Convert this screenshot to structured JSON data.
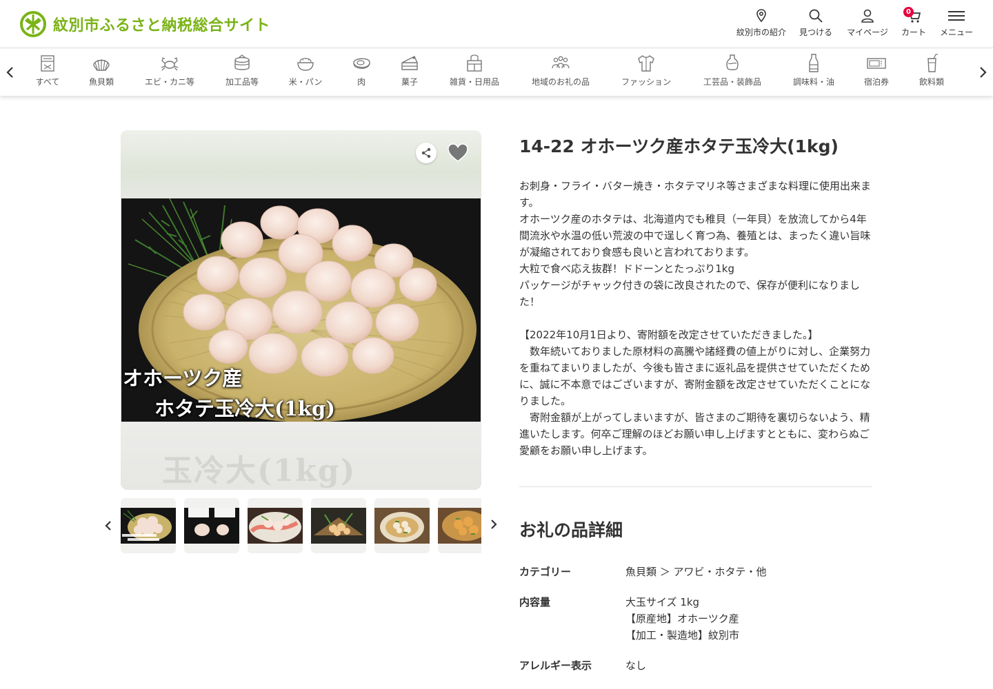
{
  "header": {
    "site_title": "紋別市ふるさと納税総合サイト",
    "nav": [
      {
        "label": "紋別市の紹介",
        "icon": "location-pin-icon"
      },
      {
        "label": "見つける",
        "icon": "search-icon"
      },
      {
        "label": "マイページ",
        "icon": "user-icon"
      },
      {
        "label": "カート",
        "icon": "cart-icon",
        "badge": "0"
      },
      {
        "label": "メニュー",
        "icon": "hamburger-menu-icon"
      }
    ]
  },
  "categories": [
    {
      "label": "すべて",
      "icon": "all-items-icon"
    },
    {
      "label": "魚貝類",
      "icon": "shell-icon"
    },
    {
      "label": "エビ・カニ等",
      "icon": "crab-icon"
    },
    {
      "label": "加工品等",
      "icon": "can-icon"
    },
    {
      "label": "米・パン",
      "icon": "rice-bowl-icon"
    },
    {
      "label": "肉",
      "icon": "meat-icon"
    },
    {
      "label": "菓子",
      "icon": "cake-icon"
    },
    {
      "label": "雑貨・日用品",
      "icon": "shopping-bag-icon"
    },
    {
      "label": "地域のお礼の品",
      "icon": "people-icon"
    },
    {
      "label": "ファッション",
      "icon": "shirt-icon"
    },
    {
      "label": "工芸品・装飾品",
      "icon": "vase-icon"
    },
    {
      "label": "調味料・油",
      "icon": "bottle-icon"
    },
    {
      "label": "宿泊券",
      "icon": "ticket-icon"
    },
    {
      "label": "飲料類",
      "icon": "drink-icon"
    }
  ],
  "product": {
    "image_caption_line1": "オホーツク産",
    "image_caption_line2": "ホタテ玉冷大(1kg)",
    "image_blur_text": "玉冷大(1kg)",
    "title": "14-22 オホーツク産ホタテ玉冷大(1kg)",
    "description": [
      "お刺身・フライ・バター焼き・ホタテマリネ等さまざまな料理に使用出来ます。",
      "オホーツク産のホタテは、北海道内でも稚貝（一年貝）を放流してから4年間流氷や水温の低い荒波の中で逞しく育つ為、養殖とは、まったく違い旨味が凝縮されており食感も良いと言われております。",
      "大粒で食べ応え抜群！ドドーンとたっぷり1kg",
      "パッケージがチャック付きの袋に改良されたので、保存が便利になりました！",
      "",
      "【2022年10月1日より、寄附額を改定させていただきました。】",
      "　数年続いておりました原材料の高騰や諸経費の値上がりに対し、企業努力を重ねてまいりましたが、今後も皆さまに返礼品を提供させていただくために、誠に不本意ではございますが、寄附金額を改定させていただくことになりました。",
      "　寄附金額が上がってしまいますが、皆さまのご期待を裏切らないよう、精進いたします。何卒ご理解のほどお願い申し上げますとともに、変わらぬご愛顧をお願い申し上げます。"
    ]
  },
  "details": {
    "heading": "お礼の品詳細",
    "rows": [
      {
        "key": "カテゴリー",
        "value": [
          "魚貝類 ＞ アワビ・ホタテ・他"
        ]
      },
      {
        "key": "内容量",
        "value": [
          "大玉サイズ 1kg",
          "【原産地】オホーツク産",
          "【加工・製造地】紋別市"
        ]
      },
      {
        "key": "アレルギー表示",
        "value": [
          "なし"
        ]
      }
    ]
  },
  "colors": {
    "brand_green": "#7ab317",
    "cart_badge": "#e6003e"
  }
}
